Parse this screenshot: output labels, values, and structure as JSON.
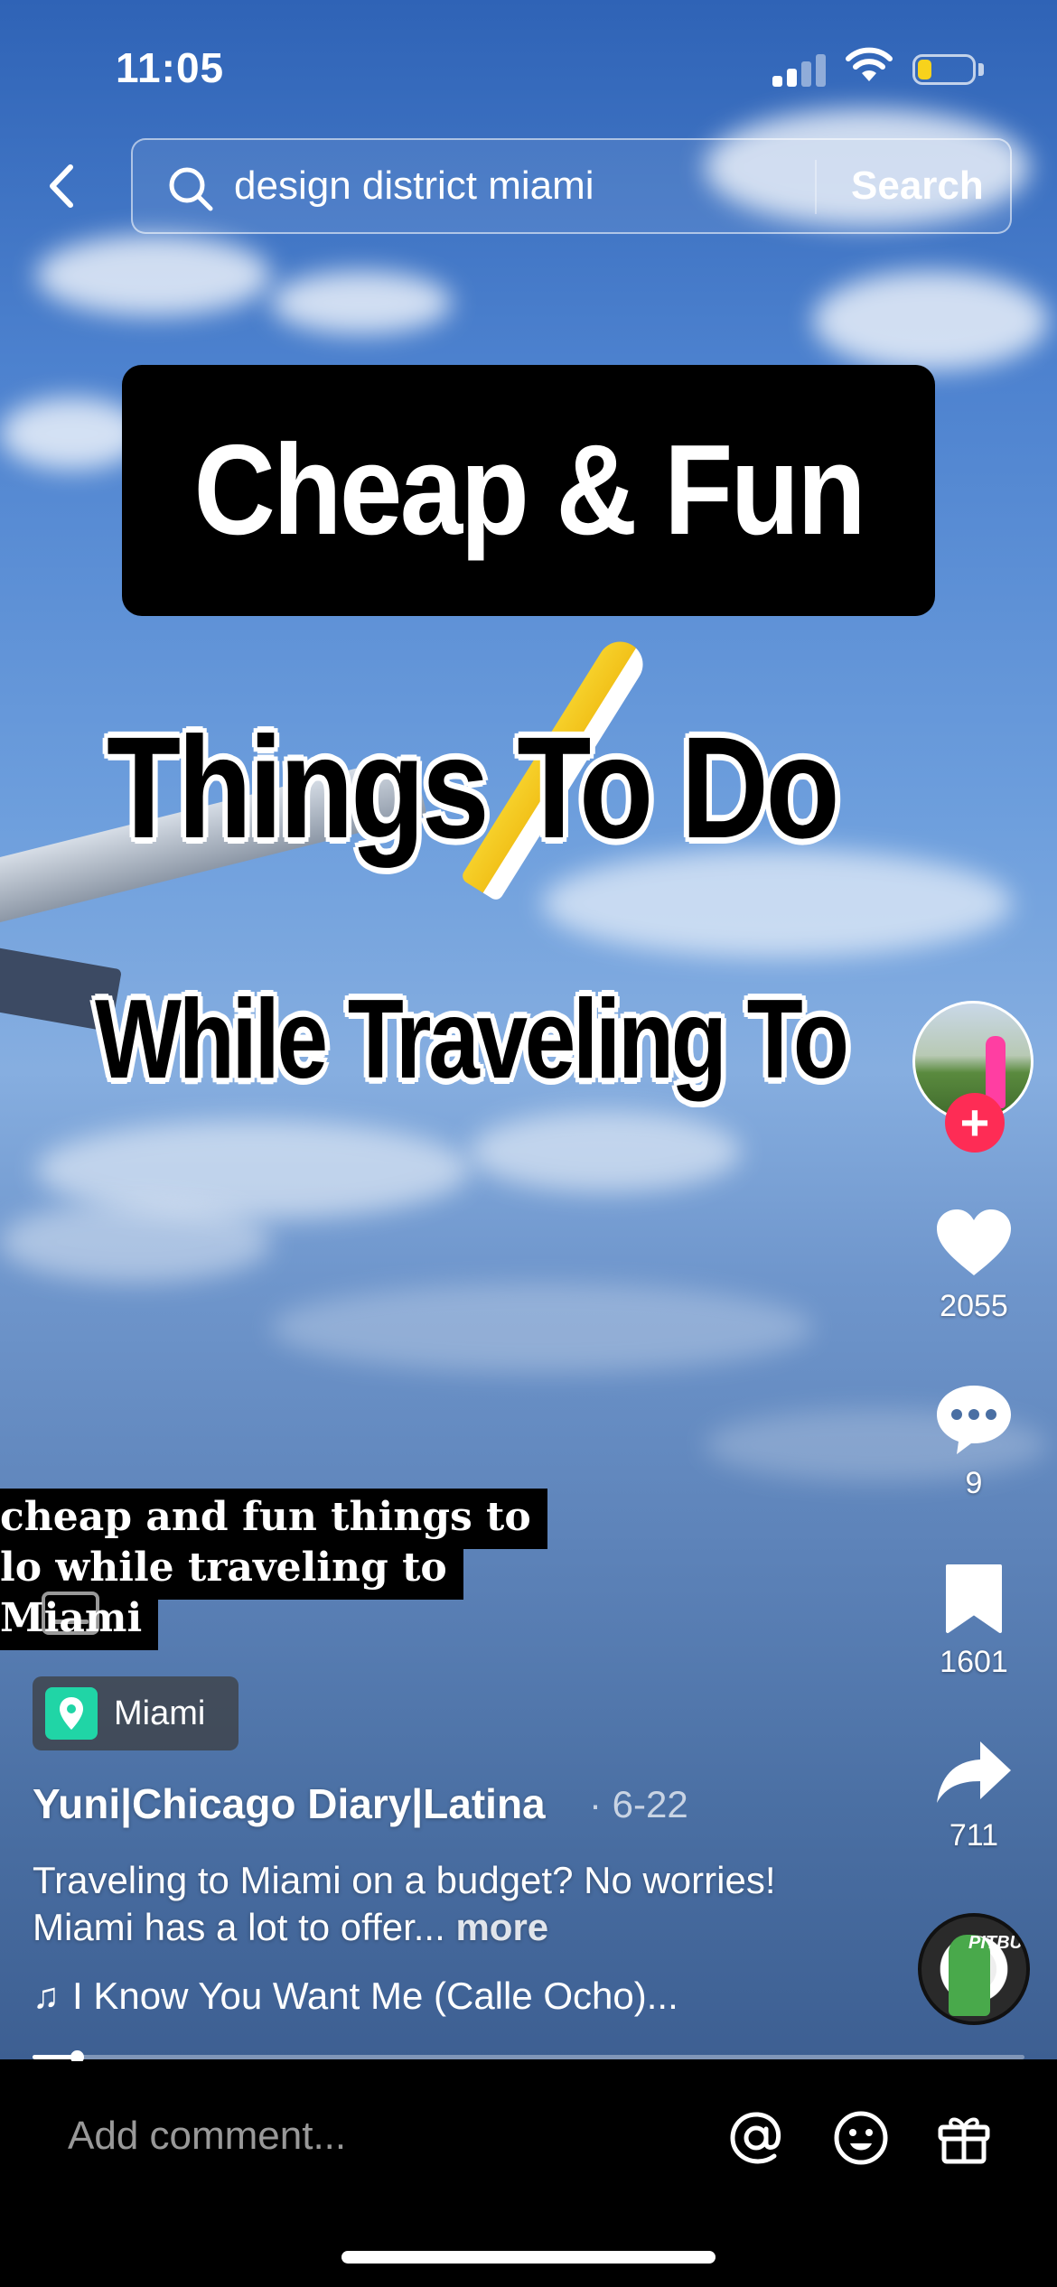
{
  "status_bar": {
    "time": "11:05",
    "battery_level": 0.25,
    "battery_color": "#f7d21c",
    "signal_bars": 2
  },
  "search": {
    "query": "design district miami",
    "button_label": "Search"
  },
  "video_overlay": {
    "line1": "Cheap & Fun",
    "line2": "Things To Do",
    "line3": "While Traveling  To"
  },
  "actions": {
    "likes": "2055",
    "comments": "9",
    "saves": "1601",
    "shares": "711",
    "follow_symbol": "+",
    "follow_color": "#fe2c55"
  },
  "music_disc": {
    "label": "PITBU"
  },
  "caption": {
    "lines": [
      "cheap and fun things to",
      "lo while traveling to",
      "Miami"
    ]
  },
  "location": {
    "label": "Miami",
    "icon": "location-pin-icon",
    "color": "#20d5a6"
  },
  "post": {
    "username": "Yuni|Chicago Diary|Latina",
    "date": "· 6-22",
    "description": "Traveling to Miami on a budget? No worries! Miami has a lot to offer...",
    "more_label": "more",
    "music": "I Know You Want Me (Calle Ocho)..."
  },
  "progress": {
    "fraction": 0.045
  },
  "comment_bar": {
    "placeholder": "Add comment...",
    "icons": [
      "mention-icon",
      "emoji-icon",
      "gift-icon"
    ]
  }
}
